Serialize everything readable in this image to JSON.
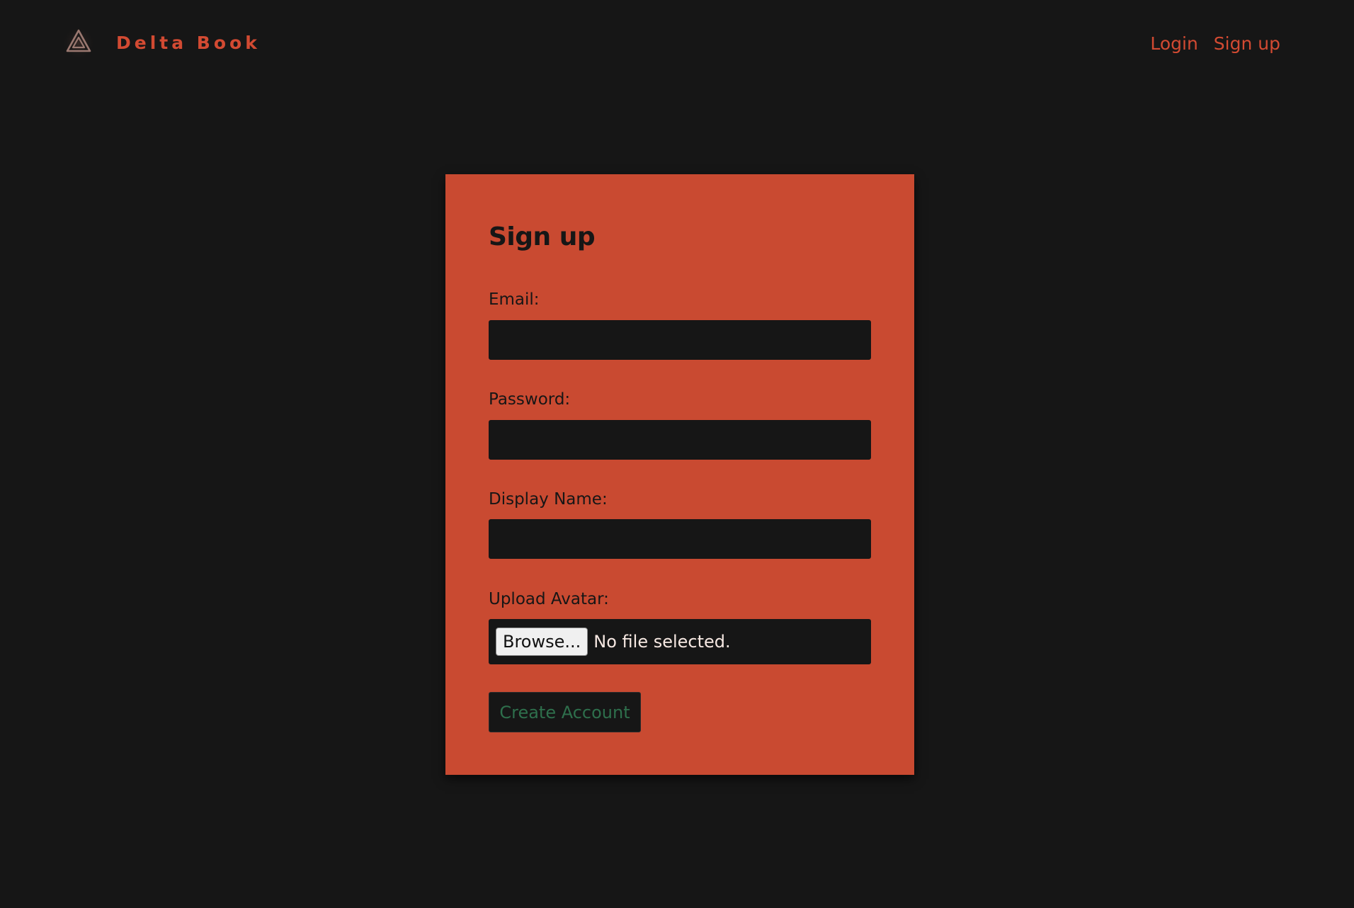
{
  "header": {
    "brand": "Delta Book",
    "nav": {
      "login_label": "Login",
      "signup_label": "Sign up"
    }
  },
  "form": {
    "title": "Sign up",
    "email_label": "Email:",
    "email_value": "",
    "password_label": "Password:",
    "password_value": "",
    "display_name_label": "Display Name:",
    "display_name_value": "",
    "avatar_label": "Upload Avatar:",
    "browse_label": "Browse...",
    "file_status": "No file selected.",
    "submit_label": "Create Account"
  },
  "icons": {
    "logo": "triangle-logo-icon"
  },
  "colors": {
    "background": "#161616",
    "accent": "#d24a32",
    "card": "#c94a31",
    "submit_text": "#2e6f4c"
  }
}
